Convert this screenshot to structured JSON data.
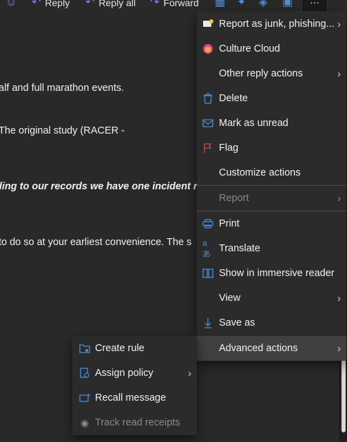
{
  "toolbar": {
    "reply_label": "Reply",
    "reply_all_label": "Reply all",
    "forward_label": "Forward",
    "more_label": "···"
  },
  "email_body": {
    "line1": "alf and full marathon events.",
    "line2": "The original study (RACER -",
    "line3": "ding to our records we have one incident r",
    "line4": "to do so at your earliest convenience. The s"
  },
  "menu": {
    "items": [
      {
        "label": "Report as junk, phishing...",
        "icon": "report-icon",
        "chevron": "›"
      },
      {
        "label": "Culture Cloud",
        "icon": "culture-cloud-icon"
      },
      {
        "label": "Other reply actions",
        "icon": "",
        "chevron": "›"
      },
      {
        "label": "Delete",
        "icon": "trash-icon"
      },
      {
        "label": "Mark as unread",
        "icon": "envelope-icon"
      },
      {
        "label": "Flag",
        "icon": "flag-icon"
      },
      {
        "label": "Customize actions",
        "icon": ""
      },
      {
        "label": "Report",
        "icon": "",
        "chevron": "›",
        "disabled": true
      },
      {
        "label": "Print",
        "icon": "print-icon"
      },
      {
        "label": "Translate",
        "icon": "translate-icon"
      },
      {
        "label": "Show in immersive reader",
        "icon": "immersive-reader-icon"
      },
      {
        "label": "View",
        "icon": "",
        "chevron": "›"
      },
      {
        "label": "Save as",
        "icon": "download-icon"
      },
      {
        "label": "Advanced actions",
        "icon": "",
        "chevron": "›",
        "highlighted": true
      }
    ]
  },
  "submenu": {
    "items": [
      {
        "label": "Create rule",
        "icon": "create-rule-icon"
      },
      {
        "label": "Assign policy",
        "icon": "policy-icon",
        "chevron": "›"
      },
      {
        "label": "Recall message",
        "icon": "recall-icon"
      },
      {
        "label": "Track read receipts",
        "icon": "read-receipt-icon",
        "disabled": true
      }
    ]
  },
  "colors": {
    "accent": "#4e8fd7",
    "background": "#292929",
    "menu_bg": "#2b2b2b",
    "highlight": "#404040"
  }
}
